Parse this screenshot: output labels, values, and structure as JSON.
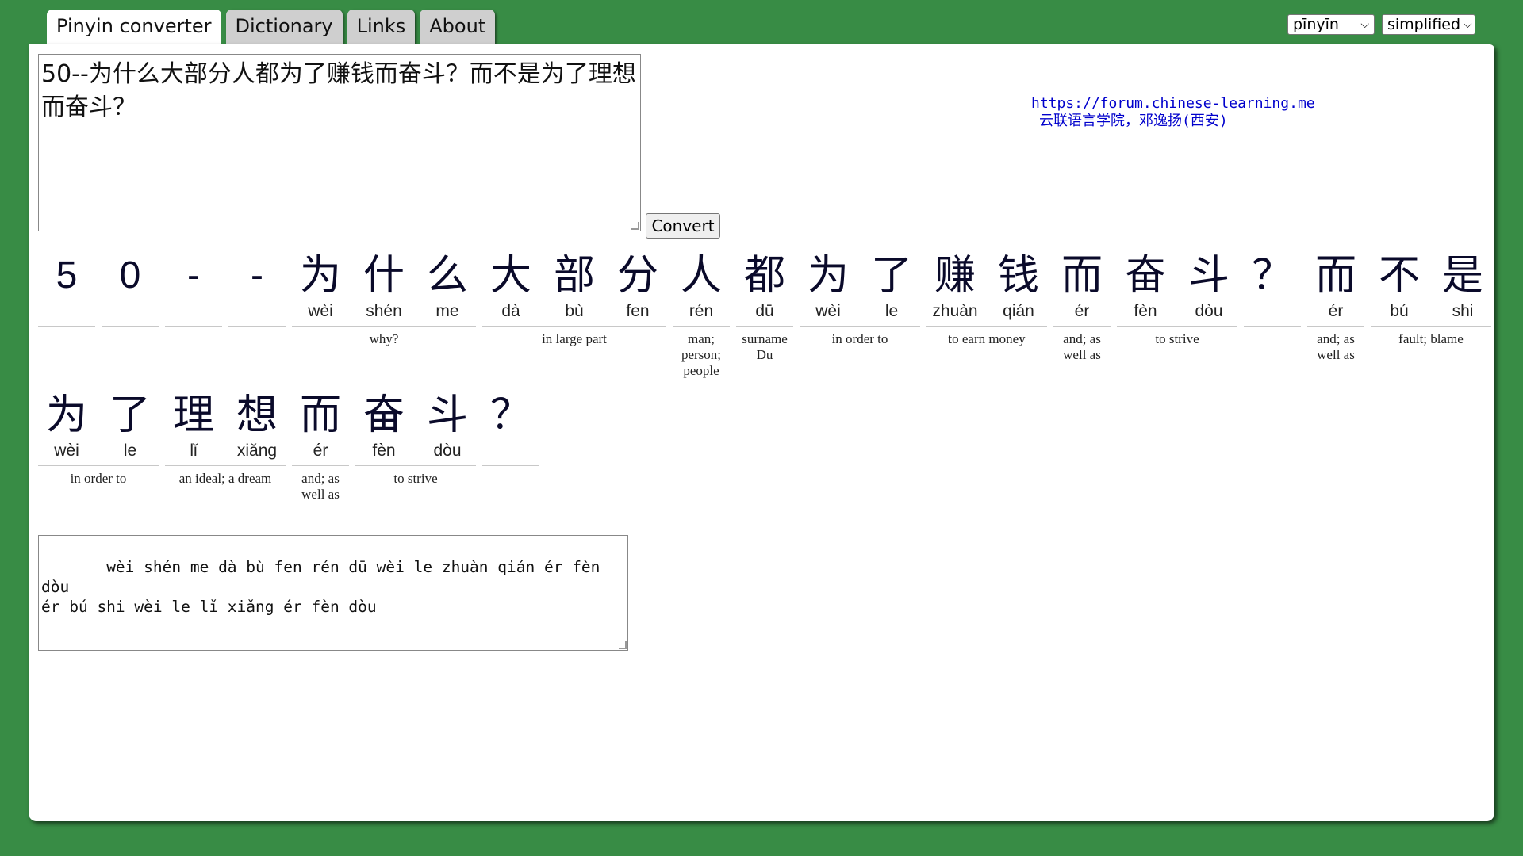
{
  "tabs": [
    {
      "label": "Pinyin converter"
    },
    {
      "label": "Dictionary"
    },
    {
      "label": "Links"
    },
    {
      "label": "About"
    }
  ],
  "selects": {
    "romanization": "pīnyīn",
    "script": "simplified"
  },
  "input": {
    "text": "50--为什么大部分人都为了赚钱而奋斗？而不是为了理想而奋斗？"
  },
  "convert_label": "Convert",
  "credit": {
    "url": "https://forum.chinese-learning.me",
    "org": "云联语言学院，邓逸扬(西安)"
  },
  "row1": {
    "chars": [
      {
        "c": "5",
        "p": ""
      },
      {
        "c": "0",
        "p": ""
      },
      {
        "c": "-",
        "p": ""
      },
      {
        "c": "-",
        "p": ""
      },
      {
        "c": "为",
        "p": "wèi"
      },
      {
        "c": "什",
        "p": "shén"
      },
      {
        "c": "么",
        "p": "me"
      },
      {
        "c": "大",
        "p": "dà"
      },
      {
        "c": "部",
        "p": "bù"
      },
      {
        "c": "分",
        "p": "fen"
      },
      {
        "c": "人",
        "p": "rén"
      },
      {
        "c": "都",
        "p": "dū"
      },
      {
        "c": "为",
        "p": "wèi"
      },
      {
        "c": "了",
        "p": "le"
      },
      {
        "c": "赚",
        "p": "zhuàn"
      },
      {
        "c": "钱",
        "p": "qián"
      },
      {
        "c": "而",
        "p": "ér"
      },
      {
        "c": "奋",
        "p": "fèn"
      },
      {
        "c": "斗",
        "p": "dòu"
      },
      {
        "c": "？",
        "p": ""
      },
      {
        "c": "而",
        "p": "ér"
      },
      {
        "c": "不",
        "p": "bú"
      },
      {
        "c": "是",
        "p": "shi"
      }
    ],
    "groups": [
      {
        "span": 1,
        "def": ""
      },
      {
        "span": 1,
        "def": ""
      },
      {
        "span": 1,
        "def": ""
      },
      {
        "span": 1,
        "def": ""
      },
      {
        "span": 3,
        "def": "why?"
      },
      {
        "span": 3,
        "def": "in large part"
      },
      {
        "span": 1,
        "def": "man; person; people"
      },
      {
        "span": 1,
        "def": "surname Du"
      },
      {
        "span": 2,
        "def": "in order to"
      },
      {
        "span": 2,
        "def": "to earn money"
      },
      {
        "span": 1,
        "def": "and; as well as"
      },
      {
        "span": 2,
        "def": "to strive"
      },
      {
        "span": 1,
        "def": ""
      },
      {
        "span": 1,
        "def": "and; as well as"
      },
      {
        "span": 2,
        "def": "fault; blame"
      }
    ]
  },
  "row2": {
    "chars": [
      {
        "c": "为",
        "p": "wèi"
      },
      {
        "c": "了",
        "p": "le"
      },
      {
        "c": "理",
        "p": "lǐ"
      },
      {
        "c": "想",
        "p": "xiǎng"
      },
      {
        "c": "而",
        "p": "ér"
      },
      {
        "c": "奋",
        "p": "fèn"
      },
      {
        "c": "斗",
        "p": "dòu"
      },
      {
        "c": "？",
        "p": ""
      }
    ],
    "groups": [
      {
        "span": 2,
        "def": "in order to"
      },
      {
        "span": 2,
        "def": "an ideal; a dream"
      },
      {
        "span": 1,
        "def": "and; as well as"
      },
      {
        "span": 2,
        "def": "to strive"
      },
      {
        "span": 1,
        "def": ""
      }
    ]
  },
  "output": {
    "text": "   wèi shén me dà bù fen rén dū wèi le zhuàn qián ér fèn dòu\nér bú shi wèi le lǐ xiǎng ér fèn dòu"
  }
}
